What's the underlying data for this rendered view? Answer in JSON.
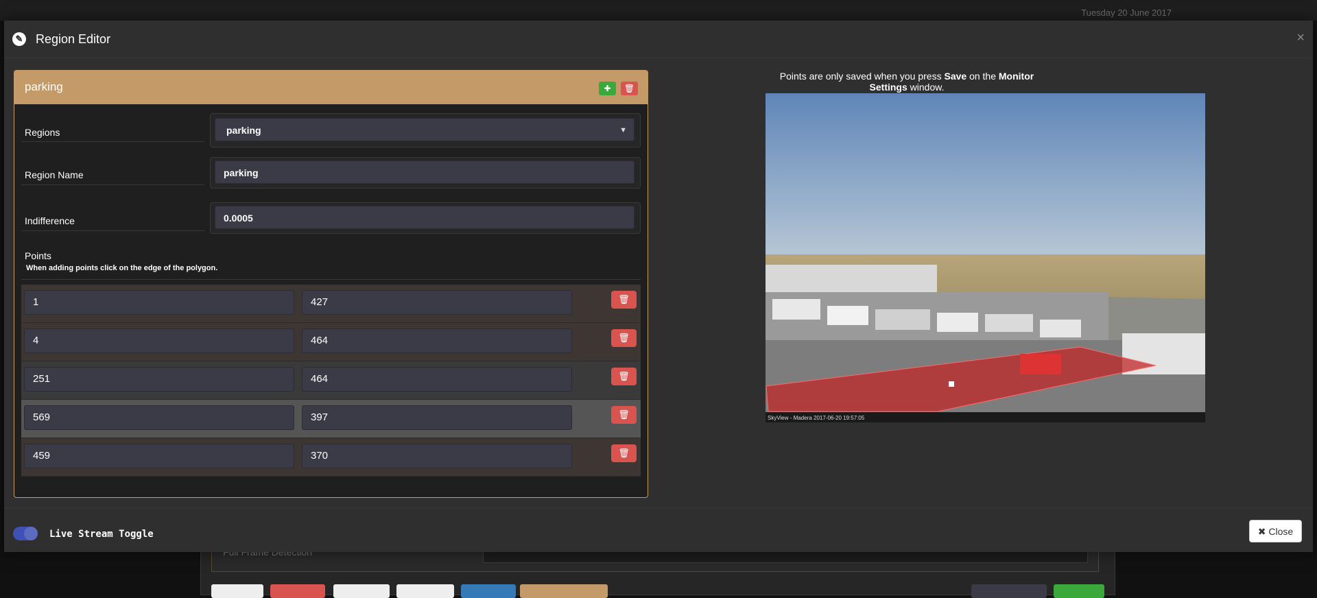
{
  "background": {
    "date": "Tuesday 20 June 2017",
    "full_frame_label": "Full Frame Detection"
  },
  "modal": {
    "title": "Region Editor",
    "close_x": "×"
  },
  "region_card": {
    "title": "parking",
    "add_icon": "plus-icon",
    "delete_icon": "trash-icon",
    "fields": {
      "regions_label": "Regions",
      "regions_value": "parking",
      "region_name_label": "Region Name",
      "region_name_value": "parking",
      "indifference_label": "Indifference",
      "indifference_value": "0.0005"
    },
    "points_label": "Points",
    "points_hint": "When adding points click on the edge of the polygon.",
    "points": [
      {
        "x": "1",
        "y": "427"
      },
      {
        "x": "4",
        "y": "464"
      },
      {
        "x": "251",
        "y": "464"
      },
      {
        "x": "569",
        "y": "397"
      },
      {
        "x": "459",
        "y": "370"
      }
    ]
  },
  "notice": {
    "prefix": "Points are only saved when you press ",
    "save": "Save",
    "middle": " on the ",
    "settings": "Monitor Settings",
    "suffix": " window."
  },
  "camera": {
    "overlay_text": "SkyView - Madera 2017-06-20 19:57:05",
    "region_fill": "#c0282a"
  },
  "footer": {
    "toggle_label": "Live Stream Toggle",
    "toggle_on": true,
    "close_label": "Close"
  },
  "colors": {
    "card_header": "#c49a68",
    "add_button": "#3aa83a",
    "delete_button": "#d9534f",
    "toggle": "#3f51b5"
  }
}
